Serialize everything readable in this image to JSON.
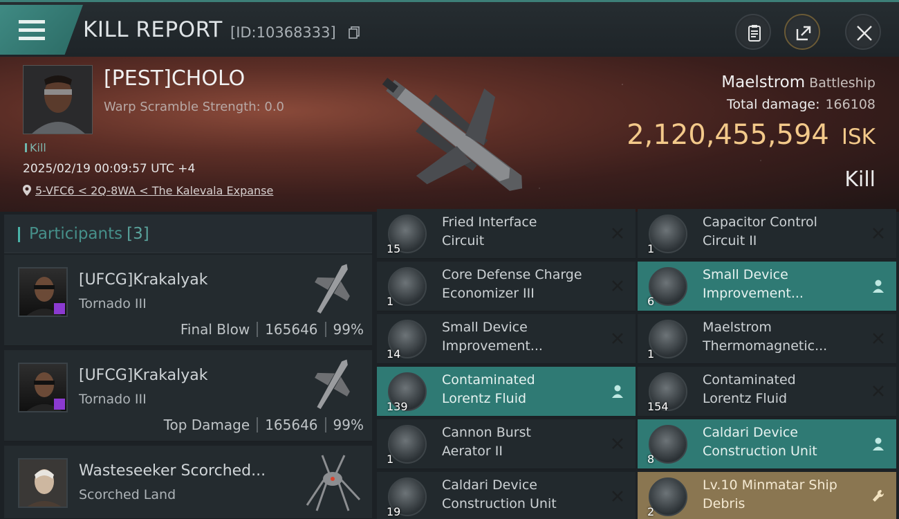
{
  "header": {
    "title": "KILL REPORT",
    "report_id": "[ID:10368333]",
    "buttons": [
      "clipboard-icon",
      "share-icon",
      "close-icon"
    ]
  },
  "victim": {
    "name": "[PEST]CHOLO",
    "scramble": "Warp Scramble Strength: 0.0",
    "tag": "Kill",
    "timestamp": "2025/02/19 00:09:57 UTC +4",
    "location": "5-VFC6 < 2Q-8WA < The Kalevala Expanse",
    "ship_name": "Maelstrom",
    "ship_class": "Battleship",
    "total_damage_label": "Total damage:",
    "total_damage": "166108",
    "isk_value": "2,120,455,594",
    "isk_unit": "ISK",
    "result": "Kill"
  },
  "participants": {
    "title": "Participants",
    "count": "[3]",
    "rows": [
      {
        "name": "[UFCG]Krakalyak",
        "ship": "Tornado III",
        "role": "Final Blow",
        "damage": "165646",
        "percent": "99%"
      },
      {
        "name": "[UFCG]Krakalyak",
        "ship": "Tornado III",
        "role": "Top Damage",
        "damage": "165646",
        "percent": "99%"
      },
      {
        "name": "Wasteseeker Scorched...",
        "ship": "Scorched Land",
        "role": "",
        "damage": "",
        "percent": ""
      }
    ]
  },
  "items": [
    {
      "name": "Fried Interface\nCircuit",
      "qty": "15",
      "state": "normal",
      "action": "close-icon"
    },
    {
      "name": "Capacitor Control\nCircuit II",
      "qty": "1",
      "state": "normal",
      "action": "close-icon"
    },
    {
      "name": "Core Defense Charge\nEconomizer III",
      "qty": "1",
      "state": "normal",
      "action": "close-icon"
    },
    {
      "name": "Small Device\nImprovement...",
      "qty": "6",
      "state": "teal",
      "action": "person-icon"
    },
    {
      "name": "Small Device\nImprovement...",
      "qty": "14",
      "state": "normal",
      "action": "close-icon"
    },
    {
      "name": "Maelstrom\nThermomagnetic...",
      "qty": "1",
      "state": "normal",
      "action": "close-icon"
    },
    {
      "name": "Contaminated\nLorentz Fluid",
      "qty": "139",
      "state": "teal",
      "action": "person-icon"
    },
    {
      "name": "Contaminated\nLorentz Fluid",
      "qty": "154",
      "state": "normal",
      "action": "close-icon"
    },
    {
      "name": "Cannon Burst\nAerator II",
      "qty": "1",
      "state": "normal",
      "action": "close-icon"
    },
    {
      "name": "Caldari Device\nConstruction Unit",
      "qty": "8",
      "state": "teal",
      "action": "person-icon"
    },
    {
      "name": "Caldari Device\nConstruction Unit",
      "qty": "19",
      "state": "normal",
      "action": "close-icon"
    },
    {
      "name": "Lv.10 Minmatar Ship\nDebris",
      "qty": "2",
      "state": "gold",
      "action": "wrench-icon"
    }
  ]
}
